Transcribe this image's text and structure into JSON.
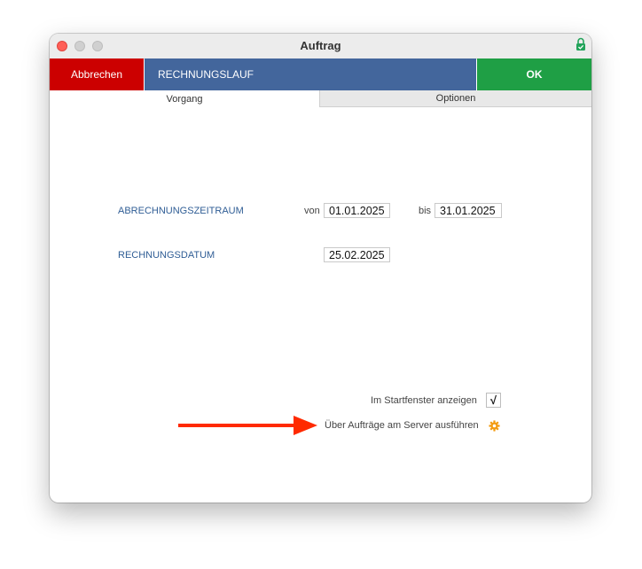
{
  "window": {
    "title": "Auftrag"
  },
  "actions": {
    "cancel_label": "Abbrechen",
    "job_title": "RECHNUNGSLAUF",
    "ok_label": "OK"
  },
  "tabs": [
    {
      "label": "Vorgang",
      "active": true
    },
    {
      "label": "Optionen",
      "active": false
    }
  ],
  "form": {
    "period_label": "ABRECHNUNGSZEITRAUM",
    "from_label": "von",
    "from_value": "01.01.2025",
    "to_label": "bis",
    "to_value": "31.01.2025",
    "invoice_date_label": "RECHNUNGSDATUM",
    "invoice_date_value": "25.02.2025"
  },
  "options": {
    "show_in_start_window_label": "Im Startfenster anzeigen",
    "show_in_start_window_checked": true,
    "check_glyph": "√",
    "run_on_server_label": "Über Aufträge am Server ausführen"
  },
  "icons": {
    "lock": "lock-icon",
    "gear": "gear-icon",
    "arrow": "arrow-right-icon"
  },
  "colors": {
    "cancel_red": "#cc0000",
    "title_blue": "#43669c",
    "ok_green": "#1f9f45",
    "label_blue": "#2f5d95",
    "arrow_red": "#ff2a00",
    "gear_orange": "#f39c12"
  }
}
